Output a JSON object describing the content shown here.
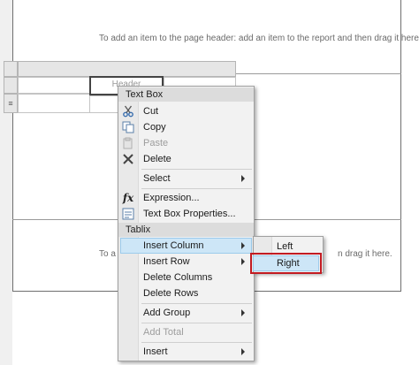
{
  "report": {
    "header_hint": "To add an item to the page header: add an item to the report and then drag it here.",
    "footer_hint_left": "To a",
    "footer_hint_right": "n drag it here.",
    "header_cell_text": "Header"
  },
  "context_menu": {
    "section_textbox": "Text Box",
    "cut": "Cut",
    "copy": "Copy",
    "paste": "Paste",
    "delete": "Delete",
    "select": "Select",
    "expression": "Expression...",
    "textbox_properties": "Text Box Properties...",
    "section_tablix": "Tablix",
    "insert_column": "Insert Column",
    "insert_row": "Insert Row",
    "delete_columns": "Delete Columns",
    "delete_rows": "Delete Rows",
    "add_group": "Add Group",
    "add_total": "Add Total",
    "insert": "Insert"
  },
  "submenu": {
    "left": "Left",
    "right": "Right"
  },
  "colors": {
    "highlight": "#cde6f7",
    "callout_border": "#c21b22"
  },
  "icons": [
    "cut-icon",
    "copy-icon",
    "paste-icon",
    "delete-icon",
    "expression-icon",
    "properties-icon",
    "submenu-arrow-icon",
    "row-handle-icon"
  ]
}
